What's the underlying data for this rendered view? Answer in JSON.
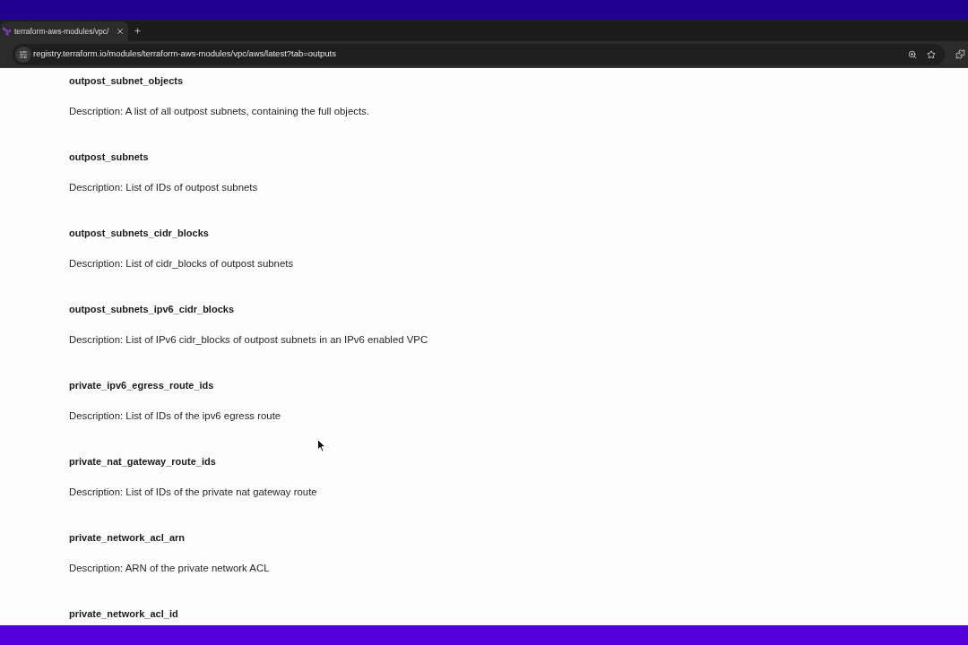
{
  "browser": {
    "tab": {
      "title": "terraform-aws-modules/vpc/"
    },
    "address_bar": {
      "url": "registry.terraform.io/modules/terraform-aws-modules/vpc/aws/latest?tab=outputs"
    }
  },
  "outputs": [
    {
      "name": "outpost_subnet_objects",
      "description": "Description: A list of all outpost subnets, containing the full objects."
    },
    {
      "name": "outpost_subnets",
      "description": "Description: List of IDs of outpost subnets"
    },
    {
      "name": "outpost_subnets_cidr_blocks",
      "description": "Description: List of cidr_blocks of outpost subnets"
    },
    {
      "name": "outpost_subnets_ipv6_cidr_blocks",
      "description": "Description: List of IPv6 cidr_blocks of outpost subnets in an IPv6 enabled VPC"
    },
    {
      "name": "private_ipv6_egress_route_ids",
      "description": "Description: List of IDs of the ipv6 egress route"
    },
    {
      "name": "private_nat_gateway_route_ids",
      "description": "Description: List of IDs of the private nat gateway route"
    },
    {
      "name": "private_network_acl_arn",
      "description": "Description: ARN of the private network ACL"
    },
    {
      "name": "private_network_acl_id"
    }
  ]
}
